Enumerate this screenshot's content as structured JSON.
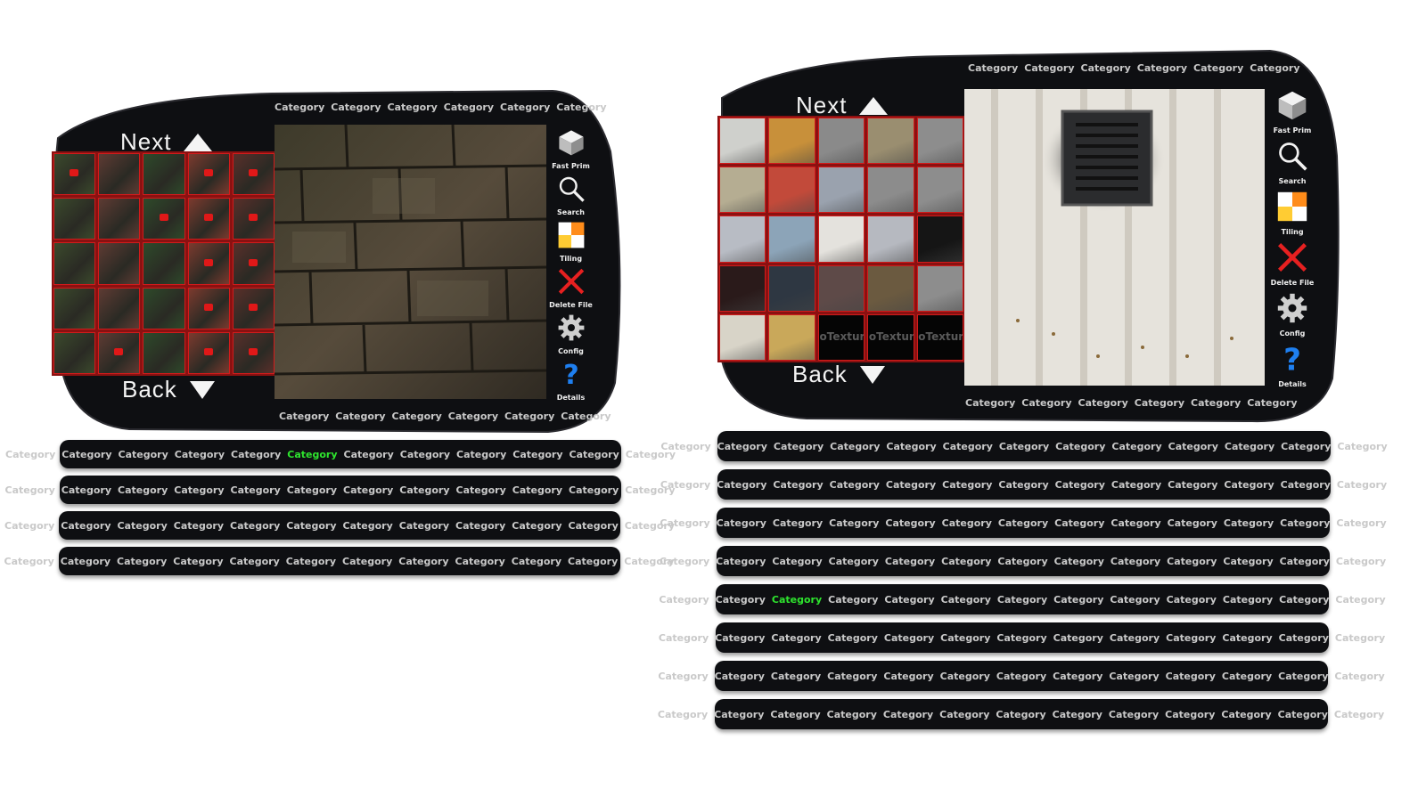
{
  "category_label": "Category",
  "left": {
    "top_categories": [
      "Category",
      "Category",
      "Category",
      "Category",
      "Category",
      "Category"
    ],
    "bottom_categories": [
      "Category",
      "Category",
      "Category",
      "Category",
      "Category",
      "Category"
    ],
    "next_label": "Next",
    "back_label": "Back",
    "tools": [
      {
        "icon": "cube-icon",
        "label": "Fast Prim"
      },
      {
        "icon": "search-icon",
        "label": "Search"
      },
      {
        "icon": "tiling-icon",
        "label": "Tiling"
      },
      {
        "icon": "delete-icon",
        "label": "Delete File"
      },
      {
        "icon": "gear-icon",
        "label": "Config"
      },
      {
        "icon": "help-icon",
        "label": "Details"
      }
    ],
    "bars": [
      {
        "items": 12,
        "active_index": 5
      },
      {
        "items": 12,
        "active_index": -1
      },
      {
        "items": 12,
        "active_index": -1
      },
      {
        "items": 12,
        "active_index": -1
      }
    ]
  },
  "right": {
    "top_categories": [
      "Category",
      "Category",
      "Category",
      "Category",
      "Category",
      "Category"
    ],
    "bottom_categories": [
      "Category",
      "Category",
      "Category",
      "Category",
      "Category",
      "Category"
    ],
    "next_label": "Next",
    "back_label": "Back",
    "no_texture_label_1": "No",
    "no_texture_label_2": "Texture",
    "tools": [
      {
        "icon": "cube-icon",
        "label": "Fast Prim"
      },
      {
        "icon": "search-icon",
        "label": "Search"
      },
      {
        "icon": "tiling-icon",
        "label": "Tiling"
      },
      {
        "icon": "delete-icon",
        "label": "Delete File"
      },
      {
        "icon": "gear-icon",
        "label": "Config"
      },
      {
        "icon": "help-icon",
        "label": "Details"
      }
    ],
    "bars": [
      {
        "items": 13,
        "active_index": -1
      },
      {
        "items": 13,
        "active_index": -1
      },
      {
        "items": 13,
        "active_index": -1
      },
      {
        "items": 13,
        "active_index": -1
      },
      {
        "items": 13,
        "active_index": 2
      },
      {
        "items": 13,
        "active_index": -1
      },
      {
        "items": 13,
        "active_index": -1
      },
      {
        "items": 13,
        "active_index": -1
      }
    ]
  },
  "colors": {
    "panel": "#0e0f12",
    "active_category": "#2ee52e",
    "grid_border": "#d21b1b"
  }
}
